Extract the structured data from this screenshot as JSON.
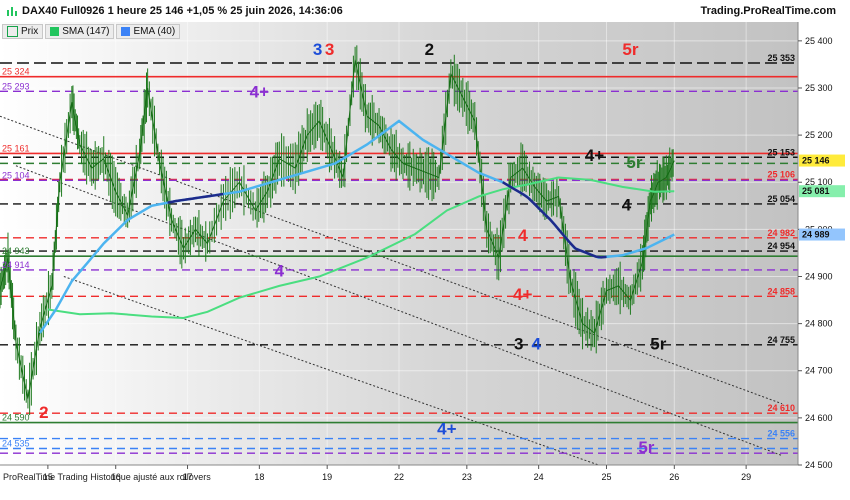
{
  "header": {
    "title": "DAX40 Full0926 1 heure 25 146 +1,05 % 25 juin 2026, 14:36:06",
    "brand": "Trading.ProRealTime.com"
  },
  "legend": [
    {
      "label": "Prix",
      "color": "#16a34a"
    },
    {
      "label": "SMA (147)",
      "color": "#22c55e"
    },
    {
      "label": "EMA (40)",
      "color": "#3b82f6"
    }
  ],
  "footer": "ProRealTime Trading  Historique ajusté aux rollovers",
  "chart_data": {
    "type": "line",
    "ylim": [
      24500,
      25440
    ],
    "y_ticks": [
      {
        "value": 24500,
        "label": "24 500"
      },
      {
        "value": 24600,
        "label": "24 600"
      },
      {
        "value": 24700,
        "label": "24 700"
      },
      {
        "value": 24800,
        "label": "24 800"
      },
      {
        "value": 24900,
        "label": "24 900"
      },
      {
        "value": 25000,
        "label": "25 000"
      },
      {
        "value": 25100,
        "label": "25 100"
      },
      {
        "value": 25200,
        "label": "25 200"
      },
      {
        "value": 25300,
        "label": "25 300"
      },
      {
        "value": 25400,
        "label": "25 400"
      }
    ],
    "x_ticks": [
      {
        "t": 0.06,
        "label": "15"
      },
      {
        "t": 0.145,
        "label": "16"
      },
      {
        "t": 0.235,
        "label": "17"
      },
      {
        "t": 0.325,
        "label": "18"
      },
      {
        "t": 0.41,
        "label": "19"
      },
      {
        "t": 0.5,
        "label": "22"
      },
      {
        "t": 0.585,
        "label": "23"
      },
      {
        "t": 0.675,
        "label": "24"
      },
      {
        "t": 0.76,
        "label": "25"
      },
      {
        "t": 0.845,
        "label": "26"
      },
      {
        "t": 0.935,
        "label": "29"
      }
    ],
    "price_path": [
      [
        0.0,
        24870
      ],
      [
        0.01,
        24940
      ],
      [
        0.02,
        24760
      ],
      [
        0.035,
        24640
      ],
      [
        0.05,
        24790
      ],
      [
        0.065,
        24880
      ],
      [
        0.075,
        25100
      ],
      [
        0.09,
        25270
      ],
      [
        0.1,
        25180
      ],
      [
        0.115,
        25130
      ],
      [
        0.13,
        25150
      ],
      [
        0.145,
        25080
      ],
      [
        0.16,
        25030
      ],
      [
        0.175,
        25160
      ],
      [
        0.185,
        25300
      ],
      [
        0.2,
        25140
      ],
      [
        0.215,
        25020
      ],
      [
        0.23,
        24960
      ],
      [
        0.245,
        25000
      ],
      [
        0.26,
        24970
      ],
      [
        0.28,
        25060
      ],
      [
        0.3,
        25100
      ],
      [
        0.32,
        25040
      ],
      [
        0.335,
        25080
      ],
      [
        0.35,
        25150
      ],
      [
        0.37,
        25130
      ],
      [
        0.385,
        25200
      ],
      [
        0.4,
        25230
      ],
      [
        0.415,
        25170
      ],
      [
        0.43,
        25110
      ],
      [
        0.445,
        25360
      ],
      [
        0.46,
        25240
      ],
      [
        0.475,
        25220
      ],
      [
        0.49,
        25170
      ],
      [
        0.505,
        25140
      ],
      [
        0.52,
        25130
      ],
      [
        0.535,
        25120
      ],
      [
        0.55,
        25110
      ],
      [
        0.565,
        25330
      ],
      [
        0.58,
        25280
      ],
      [
        0.595,
        25230
      ],
      [
        0.61,
        25000
      ],
      [
        0.625,
        24940
      ],
      [
        0.64,
        25110
      ],
      [
        0.655,
        25130
      ],
      [
        0.67,
        25090
      ],
      [
        0.685,
        25060
      ],
      [
        0.7,
        25070
      ],
      [
        0.715,
        24890
      ],
      [
        0.73,
        24800
      ],
      [
        0.745,
        24780
      ],
      [
        0.76,
        24870
      ],
      [
        0.775,
        24880
      ],
      [
        0.79,
        24850
      ],
      [
        0.805,
        24930
      ],
      [
        0.815,
        25060
      ],
      [
        0.825,
        25100
      ],
      [
        0.835,
        25110
      ],
      [
        0.845,
        25146
      ]
    ],
    "sma_path": [
      [
        0.06,
        24830
      ],
      [
        0.1,
        24820
      ],
      [
        0.14,
        24822
      ],
      [
        0.19,
        24815
      ],
      [
        0.23,
        24812
      ],
      [
        0.26,
        24825
      ],
      [
        0.3,
        24855
      ],
      [
        0.35,
        24880
      ],
      [
        0.4,
        24900
      ],
      [
        0.46,
        24940
      ],
      [
        0.52,
        24990
      ],
      [
        0.56,
        25040
      ],
      [
        0.6,
        25070
      ],
      [
        0.63,
        25085
      ],
      [
        0.66,
        25095
      ],
      [
        0.7,
        25110
      ],
      [
        0.74,
        25105
      ],
      [
        0.78,
        25090
      ],
      [
        0.82,
        25080
      ],
      [
        0.845,
        25081
      ]
    ],
    "ema_path": [
      [
        0.05,
        24780
      ],
      [
        0.07,
        24830
      ],
      [
        0.09,
        24890
      ],
      [
        0.11,
        24930
      ],
      [
        0.13,
        24970
      ],
      [
        0.16,
        25020
      ],
      [
        0.19,
        25050
      ],
      [
        0.22,
        25060
      ],
      [
        0.26,
        25070
      ],
      [
        0.3,
        25080
      ],
      [
        0.34,
        25100
      ],
      [
        0.38,
        25120
      ],
      [
        0.42,
        25140
      ],
      [
        0.46,
        25180
      ],
      [
        0.5,
        25230
      ],
      [
        0.53,
        25190
      ],
      [
        0.57,
        25150
      ],
      [
        0.6,
        25120
      ],
      [
        0.63,
        25100
      ],
      [
        0.66,
        25070
      ],
      [
        0.69,
        25020
      ],
      [
        0.72,
        24960
      ],
      [
        0.75,
        24940
      ],
      [
        0.78,
        24945
      ],
      [
        0.81,
        24960
      ],
      [
        0.845,
        24989
      ]
    ],
    "sma_dark_segments": [
      {
        "from": 0.21,
        "to": 0.28,
        "offset": 0
      },
      {
        "from": 0.63,
        "to": 0.76,
        "offset": 0
      }
    ],
    "levels": [
      {
        "value": 25353,
        "color": "#111111",
        "style": "long-dash",
        "label_right": "25 353",
        "label_left": ""
      },
      {
        "value": 25324,
        "color": "#ef2b2b",
        "style": "solid",
        "label_right": "",
        "label_left": "25 324"
      },
      {
        "value": 25293,
        "color": "#8b2fd1",
        "style": "dash",
        "label_right": "",
        "label_left": "25 293"
      },
      {
        "value": 25161,
        "color": "#ef2b2b",
        "style": "solid",
        "label_right": "",
        "label_left": "25 161"
      },
      {
        "value": 25153,
        "color": "#111111",
        "style": "dash",
        "label_right": "25 153",
        "label_left": ""
      },
      {
        "value": 25140,
        "color": "#2e7d32",
        "style": "dash",
        "label_right": "",
        "label_left": ""
      },
      {
        "value": 25106,
        "color": "#ef2b2b",
        "style": "dash",
        "label_right": "25 106",
        "label_left": ""
      },
      {
        "value": 25104,
        "color": "#8b2fd1",
        "style": "dash",
        "label_right": "",
        "label_left": "25 104"
      },
      {
        "value": 25054,
        "color": "#111111",
        "style": "dash",
        "label_right": "25 054",
        "label_left": ""
      },
      {
        "value": 24982,
        "color": "#ef2b2b",
        "style": "dash",
        "label_right": "24 982",
        "label_left": ""
      },
      {
        "value": 24954,
        "color": "#111111",
        "style": "dash",
        "label_right": "24 954",
        "label_left": ""
      },
      {
        "value": 24943,
        "color": "#2e7d32",
        "style": "solid",
        "label_right": "",
        "label_left": "24 943"
      },
      {
        "value": 24914,
        "color": "#8b2fd1",
        "style": "dash",
        "label_right": "",
        "label_left": "24 914"
      },
      {
        "value": 24858,
        "color": "#ef2b2b",
        "style": "dash",
        "label_right": "24 858",
        "label_left": ""
      },
      {
        "value": 24755,
        "color": "#111111",
        "style": "dash",
        "label_right": "24 755",
        "label_left": ""
      },
      {
        "value": 24610,
        "color": "#ef2b2b",
        "style": "dash",
        "label_right": "24 610",
        "label_left": ""
      },
      {
        "value": 24590,
        "color": "#2e7d32",
        "style": "solid",
        "label_right": "",
        "label_left": "24 590"
      },
      {
        "value": 24556,
        "color": "#3b82f6",
        "style": "dash",
        "label_right": "24 556",
        "label_left": ""
      },
      {
        "value": 24535,
        "color": "#3b82f6",
        "style": "dash",
        "label_right": "",
        "label_left": "24 535"
      },
      {
        "value": 24525,
        "color": "#8b2fd1",
        "style": "dash",
        "label_right": "",
        "label_left": ""
      }
    ],
    "price_badges": [
      {
        "value": 25146,
        "label": "25 146",
        "bg": "#ffeb3b",
        "fg": "#111111"
      },
      {
        "value": 25081,
        "label": "25 081",
        "bg": "#86efac",
        "fg": "#111111"
      },
      {
        "value": 24989,
        "label": "24 989",
        "bg": "#93c5fd",
        "fg": "#111111"
      }
    ],
    "annotations": [
      {
        "t": 0.398,
        "value": 25370,
        "text": "3",
        "color": "#1d4ed8",
        "size": 17
      },
      {
        "t": 0.413,
        "value": 25370,
        "text": "3",
        "color": "#ef2b2b",
        "size": 17
      },
      {
        "t": 0.538,
        "value": 25370,
        "text": "2",
        "color": "#111111",
        "size": 17
      },
      {
        "t": 0.79,
        "value": 25370,
        "text": "5r",
        "color": "#ef2b2b",
        "size": 17
      },
      {
        "t": 0.325,
        "value": 25280,
        "text": "4+",
        "color": "#8b2fd1",
        "size": 17
      },
      {
        "t": 0.745,
        "value": 25145,
        "text": "4+",
        "color": "#111111",
        "size": 17
      },
      {
        "t": 0.795,
        "value": 25130,
        "text": "5r",
        "color": "#2e7d32",
        "size": 17
      },
      {
        "t": 0.785,
        "value": 25040,
        "text": "4",
        "color": "#111111",
        "size": 17
      },
      {
        "t": 0.655,
        "value": 24975,
        "text": "4",
        "color": "#ef2b2b",
        "size": 17
      },
      {
        "t": 0.35,
        "value": 24900,
        "text": "4",
        "color": "#8b2fd1",
        "size": 17
      },
      {
        "t": 0.655,
        "value": 24850,
        "text": "4+",
        "color": "#ef2b2b",
        "size": 17
      },
      {
        "t": 0.65,
        "value": 24745,
        "text": "3",
        "color": "#111111",
        "size": 17
      },
      {
        "t": 0.672,
        "value": 24745,
        "text": "4",
        "color": "#1d4ed8",
        "size": 17
      },
      {
        "t": 0.825,
        "value": 24745,
        "text": "5r",
        "color": "#111111",
        "size": 17
      },
      {
        "t": 0.055,
        "value": 24600,
        "text": "2",
        "color": "#ef2b2b",
        "size": 17
      },
      {
        "t": 0.56,
        "value": 24565,
        "text": "4+",
        "color": "#1d4ed8",
        "size": 17
      },
      {
        "t": 0.81,
        "value": 24525,
        "text": "5r",
        "color": "#8b2fd1",
        "size": 17
      }
    ]
  }
}
